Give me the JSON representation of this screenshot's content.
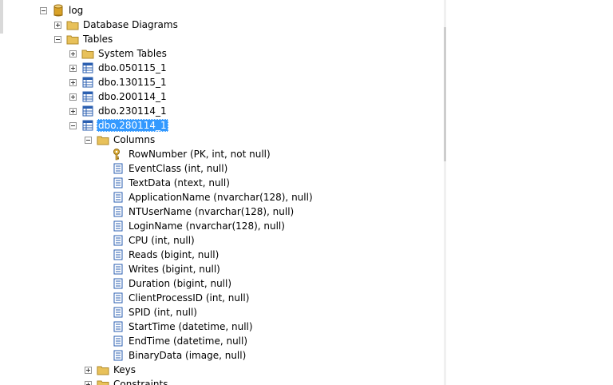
{
  "tree": {
    "database": {
      "label": "log",
      "icon": "database-icon"
    },
    "diagrams": {
      "label": "Database Diagrams",
      "icon": "folder-icon"
    },
    "tables": {
      "label": "Tables",
      "icon": "folder-icon"
    },
    "system_tables": {
      "label": "System Tables",
      "icon": "folder-icon"
    },
    "table_items": [
      {
        "label": "dbo.050115_1",
        "icon": "table-icon",
        "selected": false
      },
      {
        "label": "dbo.130115_1",
        "icon": "table-icon",
        "selected": false
      },
      {
        "label": "dbo.200114_1",
        "icon": "table-icon",
        "selected": false
      },
      {
        "label": "dbo.230114_1",
        "icon": "table-icon",
        "selected": false
      },
      {
        "label": "dbo.280114_1",
        "icon": "table-icon",
        "selected": true
      }
    ],
    "columns_folder": {
      "label": "Columns",
      "icon": "folder-icon"
    },
    "columns": [
      {
        "label": "RowNumber (PK, int, not null)",
        "icon": "key-icon"
      },
      {
        "label": "EventClass (int, null)",
        "icon": "column-icon"
      },
      {
        "label": "TextData (ntext, null)",
        "icon": "column-icon"
      },
      {
        "label": "ApplicationName (nvarchar(128), null)",
        "icon": "column-icon"
      },
      {
        "label": "NTUserName (nvarchar(128), null)",
        "icon": "column-icon"
      },
      {
        "label": "LoginName (nvarchar(128), null)",
        "icon": "column-icon"
      },
      {
        "label": "CPU (int, null)",
        "icon": "column-icon"
      },
      {
        "label": "Reads (bigint, null)",
        "icon": "column-icon"
      },
      {
        "label": "Writes (bigint, null)",
        "icon": "column-icon"
      },
      {
        "label": "Duration (bigint, null)",
        "icon": "column-icon"
      },
      {
        "label": "ClientProcessID (int, null)",
        "icon": "column-icon"
      },
      {
        "label": "SPID (int, null)",
        "icon": "column-icon"
      },
      {
        "label": "StartTime (datetime, null)",
        "icon": "column-icon"
      },
      {
        "label": "EndTime (datetime, null)",
        "icon": "column-icon"
      },
      {
        "label": "BinaryData (image, null)",
        "icon": "column-icon"
      }
    ],
    "keys_folder": {
      "label": "Keys",
      "icon": "folder-icon"
    },
    "constraints_folder": {
      "label": "Constraints",
      "icon": "folder-icon"
    }
  },
  "colors": {
    "selection": "#3399ff",
    "folder": "#e8c15a",
    "database": "#d9a227",
    "table_blue": "#2b5fb0",
    "key": "#d8a52a"
  }
}
